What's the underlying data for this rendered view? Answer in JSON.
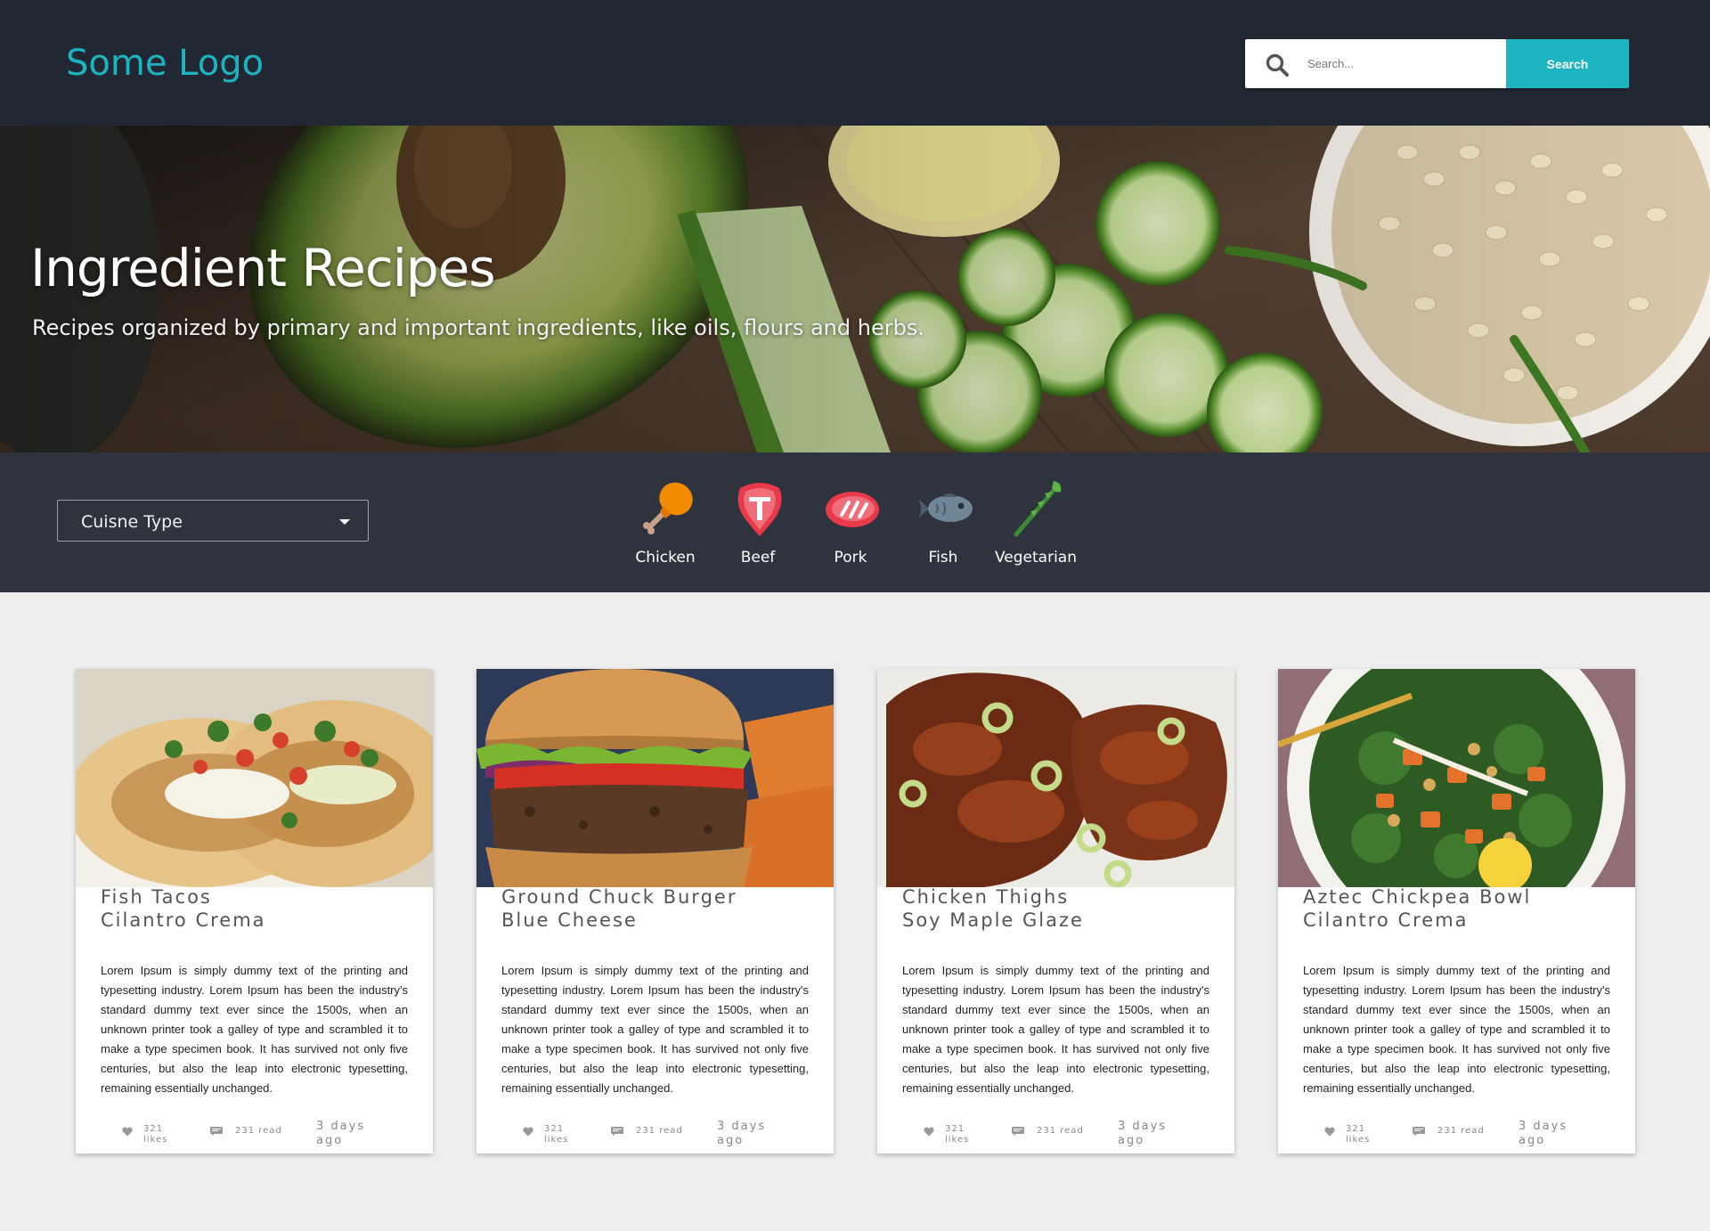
{
  "header": {
    "logo": "Some Logo",
    "search_placeholder": "Search...",
    "search_button": "Search"
  },
  "hero": {
    "title": "Ingredient Recipes",
    "subtitle": "Recipes organized by primary and important ingredients, like oils, flours and herbs."
  },
  "filter": {
    "cuisine_label": "Cuisne Type",
    "categories": [
      {
        "label": "Chicken",
        "icon": "chicken-drumstick-icon"
      },
      {
        "label": "Beef",
        "icon": "steak-icon"
      },
      {
        "label": "Pork",
        "icon": "pork-icon"
      },
      {
        "label": "Fish",
        "icon": "fish-icon"
      },
      {
        "label": "Vegetarian",
        "icon": "asparagus-icon"
      }
    ]
  },
  "cards": [
    {
      "title_line1": "Fish Tacos",
      "title_line2": "Cilantro Crema",
      "text": "Lorem Ipsum is simply dummy text of the printing and typesetting industry. Lorem Ipsum has been the industry's standard dummy text ever since the 1500s, when an unknown printer took a galley of type and scrambled it to make a type specimen book. It has survived not only five centuries, but also the leap into electronic typesetting, remaining essentially unchanged.",
      "likes": "321",
      "likes_label": "likes",
      "reads": "231 read",
      "ago_line1": "3 days",
      "ago_line2": "ago"
    },
    {
      "title_line1": "Ground Chuck Burger",
      "title_line2": "Blue Cheese",
      "text": "Lorem Ipsum is simply dummy text of the printing and typesetting industry. Lorem Ipsum has been the industry's standard dummy text ever since the 1500s, when an unknown printer took a galley of type and scrambled it to make a type specimen book. It has survived not only five centuries, but also the leap into electronic typesetting, remaining essentially unchanged.",
      "likes": "321",
      "likes_label": "likes",
      "reads": "231 read",
      "ago_line1": "3 days",
      "ago_line2": "ago"
    },
    {
      "title_line1": "Chicken Thighs",
      "title_line2": "Soy Maple Glaze",
      "text": "Lorem Ipsum is simply dummy text of the printing and typesetting industry. Lorem Ipsum has been the industry's standard dummy text ever since the 1500s, when an unknown printer took a galley of type and scrambled it to make a type specimen book. It has survived not only five centuries, but also the leap into electronic typesetting, remaining essentially unchanged.",
      "likes": "321",
      "likes_label": "likes",
      "reads": "231 read",
      "ago_line1": "3 days",
      "ago_line2": "ago"
    },
    {
      "title_line1": "Aztec Chickpea Bowl",
      "title_line2": "Cilantro Crema",
      "text": "Lorem Ipsum is simply dummy text of the printing and typesetting industry. Lorem Ipsum has been the industry's standard dummy text ever since the 1500s, when an unknown printer took a galley of type and scrambled it to make a type specimen book. It has survived not only five centuries, but also the leap into electronic typesetting, remaining essentially unchanged.",
      "likes": "321",
      "likes_label": "likes",
      "reads": "231 read",
      "ago_line1": "3 days",
      "ago_line2": "ago"
    }
  ],
  "colors": {
    "accent": "#1cb4bf",
    "header_bg": "#212833",
    "filter_bg": "#2e333d",
    "page_bg": "#eeeeee"
  }
}
